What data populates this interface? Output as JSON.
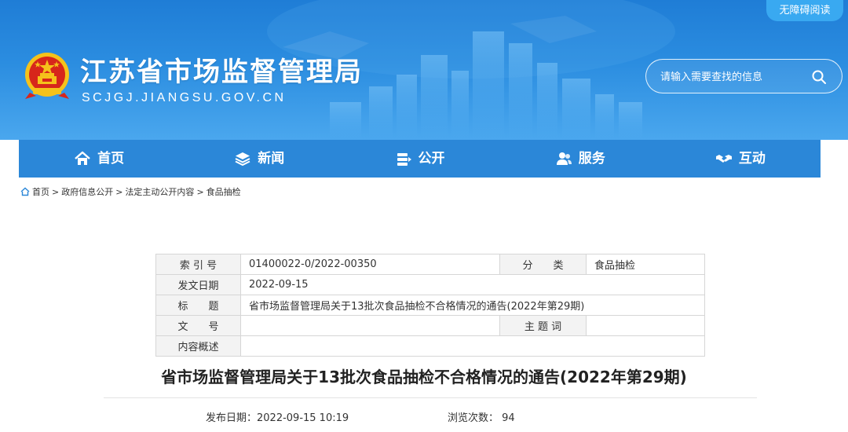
{
  "header": {
    "accessibility_label": "无障碍阅读",
    "site_title": "江苏省市场监督管理局",
    "site_domain": "SCJGJ.JIANGSU.GOV.CN",
    "search_placeholder": "请输入需要查找的信息",
    "emblem_icon": "national-emblem-icon",
    "search_icon": "search-icon"
  },
  "nav": {
    "items": [
      {
        "label": "首页",
        "icon": "home-icon"
      },
      {
        "label": "新闻",
        "icon": "layers-icon"
      },
      {
        "label": "公开",
        "icon": "stack-icon"
      },
      {
        "label": "服务",
        "icon": "people-icon"
      },
      {
        "label": "互动",
        "icon": "handshake-icon"
      }
    ]
  },
  "breadcrumb": {
    "icon": "home-icon",
    "items": [
      "首页",
      "政府信息公开",
      "法定主动公开内容",
      "食品抽检"
    ],
    "separator": ">"
  },
  "info_table": {
    "index_label": "索 引 号",
    "index_value": "01400022-0/2022-00350",
    "category_label": "分　　类",
    "category_value": "食品抽检",
    "date_label": "发文日期",
    "date_value": "2022-09-15",
    "title_label": "标　　题",
    "title_value": "省市场监督管理局关于13批次食品抽检不合格情况的通告(2022年第29期)",
    "doc_no_label": "文　　号",
    "doc_no_value": "",
    "keywords_label": "主 题 词",
    "keywords_value": "",
    "summary_label": "内容概述",
    "summary_value": ""
  },
  "article": {
    "title": "省市场监督管理局关于13批次食品抽检不合格情况的通告(2022年第29期)",
    "publish_date": "发布日期：2022-09-15 10:19",
    "views": "浏览次数： 94"
  },
  "colors": {
    "header_top": "#1f7dd6",
    "header_bottom": "#4aa7ee",
    "nav_bg": "#2b87d8",
    "accessibility_btn": "#39a9f1",
    "table_key_bg": "#f3f3f3",
    "table_border": "#d6d6d6"
  }
}
